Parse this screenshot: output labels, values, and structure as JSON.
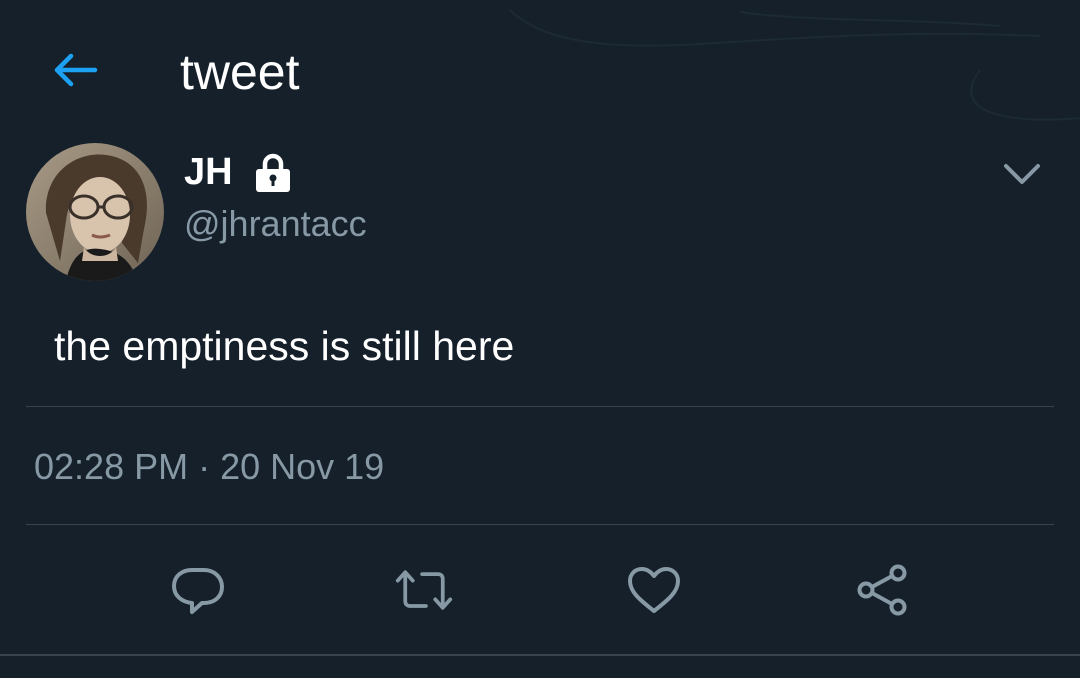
{
  "header": {
    "title": "tweet",
    "back_icon": "arrow-left-icon",
    "accent_color": "#1da1f2"
  },
  "author": {
    "name": "JH",
    "handle": "@jhrantacc",
    "protected_icon": "lock-icon",
    "more_icon": "chevron-down-icon"
  },
  "tweet": {
    "text": "the emptiness is still here",
    "timestamp": "02:28 PM · 20 Nov 19"
  },
  "actions": [
    {
      "name": "reply",
      "icon": "reply-icon"
    },
    {
      "name": "retweet",
      "icon": "retweet-icon"
    },
    {
      "name": "like",
      "icon": "heart-icon"
    },
    {
      "name": "share",
      "icon": "share-icon"
    }
  ],
  "colors": {
    "background": "#15202b",
    "text": "#ffffff",
    "secondary_text": "#8899a6",
    "divider": "#38444d"
  }
}
